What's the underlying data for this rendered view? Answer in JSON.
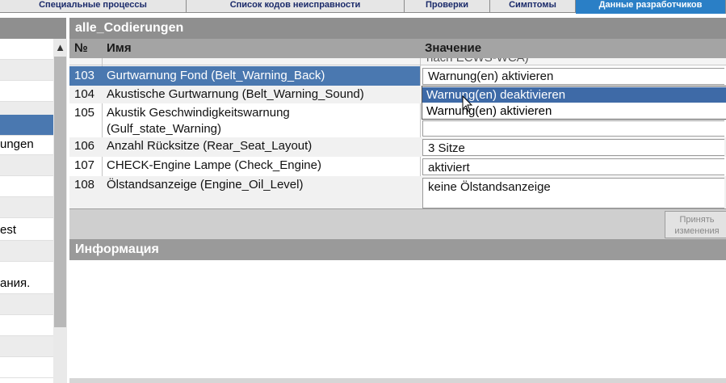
{
  "tabs": [
    {
      "label": "Специальные процессы"
    },
    {
      "label": "Список кодов неисправности"
    },
    {
      "label": "Проверки"
    },
    {
      "label": "Симптомы"
    },
    {
      "label": "Данные разработчиков"
    }
  ],
  "left_list": {
    "items": [
      "",
      "",
      "",
      "",
      "",
      "ungen",
      "",
      "",
      "",
      "est",
      "",
      "ания.",
      "",
      "",
      "",
      ""
    ],
    "scroll_up": "▲"
  },
  "table": {
    "title": "alle_Codierungen",
    "columns": {
      "num": "№",
      "name": "Имя",
      "value": "Значение"
    },
    "cut_row_value": "nach ECWS-WCA)",
    "rows": [
      {
        "num": "103",
        "name": "Gurtwarnung Fond (Belt_Warning_Back)",
        "value": "Warnung(en) aktivieren"
      },
      {
        "num": "104",
        "name": "Akustische Gurtwarnung (Belt_Warning_Sound)",
        "value": ""
      },
      {
        "num": "105",
        "name": "Akustik Geschwindigkeitswarnung",
        "name2": "(Gulf_state_Warning)",
        "value": ""
      },
      {
        "num": "106",
        "name": "Anzahl Rücksitze (Rear_Seat_Layout)",
        "value": "3 Sitze"
      },
      {
        "num": "107",
        "name": "CHECK-Engine Lampe (Check_Engine)",
        "value": "aktiviert"
      },
      {
        "num": "108",
        "name": "Ölstandsanzeige (Engine_Oil_Level)",
        "value": "keine Ölstandsanzeige"
      }
    ],
    "dropdown_options": [
      "Warnung(en) deaktivieren",
      "Warnung(en) aktivieren"
    ]
  },
  "apply_button": {
    "line1": "Принять",
    "line2": "изменения"
  },
  "info": {
    "title": "Информация"
  },
  "colors": {
    "selection": "#4a78b0",
    "active_tab": "#2a7fc6",
    "header_gray": "#8f8f8f"
  },
  "icons": {
    "cursor": "mouse-pointer-icon",
    "scroll_up": "chevron-up-icon"
  }
}
